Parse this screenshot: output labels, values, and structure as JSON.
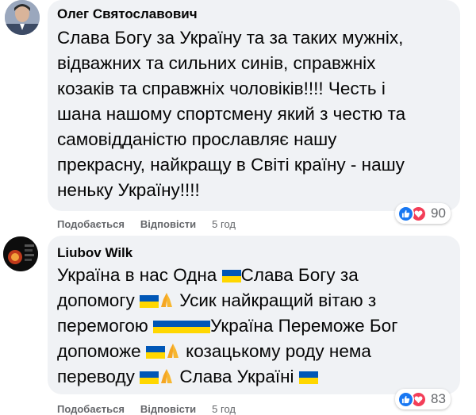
{
  "comments": [
    {
      "author": "Олег Святославович",
      "lines": [
        [
          {
            "t": "Слава Богу за Україну та за таких мужніх,"
          }
        ],
        [
          {
            "t": "відважних та сильних синів, справжніх"
          }
        ],
        [
          {
            "t": "козаків та справжніх чоловіків!!!! Честь і"
          }
        ],
        [
          {
            "t": "шана нашому спортсмену який з честю та"
          }
        ],
        [
          {
            "t": "самовідданістю прославляє нашу"
          }
        ],
        [
          {
            "t": "прекрасну, найкращу в Світі країну - нашу"
          }
        ],
        [
          {
            "t": "неньку Україну!!!!"
          }
        ]
      ],
      "actions": {
        "like": "Подобається",
        "reply": "Відповісти",
        "time": "5 год"
      },
      "reactions": {
        "count": "90",
        "icons": [
          "like-icon",
          "love-icon"
        ]
      }
    },
    {
      "author": "Liubov Wilk",
      "lines": [
        [
          {
            "t": "Україна в нас Одна "
          },
          {
            "e": "ukraine-flag-icon"
          },
          {
            "t": "Слава Богу за"
          }
        ],
        [
          {
            "t": "допомогу "
          },
          {
            "e": "ukraine-flag-icon"
          },
          {
            "e": "praying-hands-icon"
          },
          {
            "t": " Усик найкращий вітаю з"
          }
        ],
        [
          {
            "t": "перемогою "
          },
          {
            "e": "ukraine-flag-icon"
          },
          {
            "e": "ukraine-flag-icon"
          },
          {
            "e": "ukraine-flag-icon"
          },
          {
            "t": "Україна Переможе Бог"
          }
        ],
        [
          {
            "t": "допоможе "
          },
          {
            "e": "ukraine-flag-icon"
          },
          {
            "e": "praying-hands-icon"
          },
          {
            "t": " козацькому роду нема"
          }
        ],
        [
          {
            "t": "переводу "
          },
          {
            "e": "ukraine-flag-icon"
          },
          {
            "e": "praying-hands-icon"
          },
          {
            "t": " Слава Україні "
          },
          {
            "e": "ukraine-flag-icon"
          }
        ]
      ],
      "actions": {
        "like": "Подобається",
        "reply": "Відповісти",
        "time": "5 год"
      },
      "reactions": {
        "count": "83",
        "icons": [
          "like-icon",
          "love-icon"
        ]
      }
    }
  ],
  "colors": {
    "bubble": "#f0f2f5",
    "like": "#1877f2",
    "love": "#f33e58",
    "meta": "#65676b",
    "flag_blue": "#0057b7",
    "flag_yellow": "#ffd700"
  }
}
